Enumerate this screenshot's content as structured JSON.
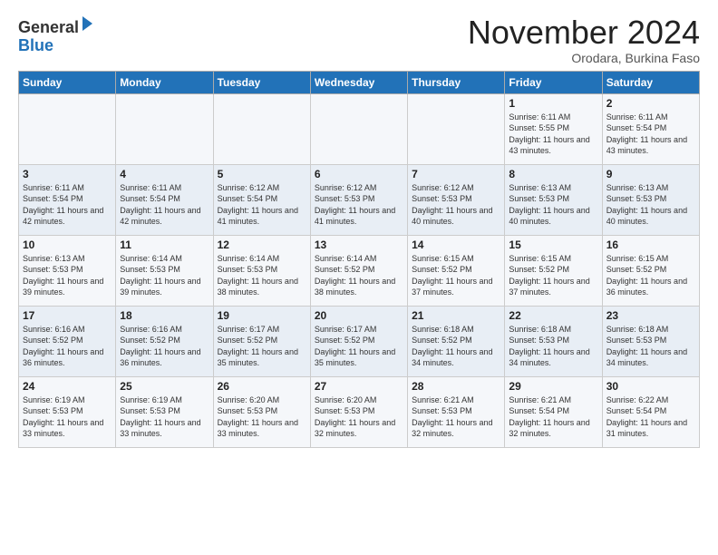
{
  "header": {
    "logo_general": "General",
    "logo_blue": "Blue",
    "month_title": "November 2024",
    "location": "Orodara, Burkina Faso"
  },
  "days_of_week": [
    "Sunday",
    "Monday",
    "Tuesday",
    "Wednesday",
    "Thursday",
    "Friday",
    "Saturday"
  ],
  "weeks": [
    [
      {
        "day": "",
        "info": ""
      },
      {
        "day": "",
        "info": ""
      },
      {
        "day": "",
        "info": ""
      },
      {
        "day": "",
        "info": ""
      },
      {
        "day": "",
        "info": ""
      },
      {
        "day": "1",
        "info": "Sunrise: 6:11 AM\nSunset: 5:55 PM\nDaylight: 11 hours\nand 43 minutes."
      },
      {
        "day": "2",
        "info": "Sunrise: 6:11 AM\nSunset: 5:54 PM\nDaylight: 11 hours\nand 43 minutes."
      }
    ],
    [
      {
        "day": "3",
        "info": "Sunrise: 6:11 AM\nSunset: 5:54 PM\nDaylight: 11 hours\nand 42 minutes."
      },
      {
        "day": "4",
        "info": "Sunrise: 6:11 AM\nSunset: 5:54 PM\nDaylight: 11 hours\nand 42 minutes."
      },
      {
        "day": "5",
        "info": "Sunrise: 6:12 AM\nSunset: 5:54 PM\nDaylight: 11 hours\nand 41 minutes."
      },
      {
        "day": "6",
        "info": "Sunrise: 6:12 AM\nSunset: 5:53 PM\nDaylight: 11 hours\nand 41 minutes."
      },
      {
        "day": "7",
        "info": "Sunrise: 6:12 AM\nSunset: 5:53 PM\nDaylight: 11 hours\nand 40 minutes."
      },
      {
        "day": "8",
        "info": "Sunrise: 6:13 AM\nSunset: 5:53 PM\nDaylight: 11 hours\nand 40 minutes."
      },
      {
        "day": "9",
        "info": "Sunrise: 6:13 AM\nSunset: 5:53 PM\nDaylight: 11 hours\nand 40 minutes."
      }
    ],
    [
      {
        "day": "10",
        "info": "Sunrise: 6:13 AM\nSunset: 5:53 PM\nDaylight: 11 hours\nand 39 minutes."
      },
      {
        "day": "11",
        "info": "Sunrise: 6:14 AM\nSunset: 5:53 PM\nDaylight: 11 hours\nand 39 minutes."
      },
      {
        "day": "12",
        "info": "Sunrise: 6:14 AM\nSunset: 5:53 PM\nDaylight: 11 hours\nand 38 minutes."
      },
      {
        "day": "13",
        "info": "Sunrise: 6:14 AM\nSunset: 5:52 PM\nDaylight: 11 hours\nand 38 minutes."
      },
      {
        "day": "14",
        "info": "Sunrise: 6:15 AM\nSunset: 5:52 PM\nDaylight: 11 hours\nand 37 minutes."
      },
      {
        "day": "15",
        "info": "Sunrise: 6:15 AM\nSunset: 5:52 PM\nDaylight: 11 hours\nand 37 minutes."
      },
      {
        "day": "16",
        "info": "Sunrise: 6:15 AM\nSunset: 5:52 PM\nDaylight: 11 hours\nand 36 minutes."
      }
    ],
    [
      {
        "day": "17",
        "info": "Sunrise: 6:16 AM\nSunset: 5:52 PM\nDaylight: 11 hours\nand 36 minutes."
      },
      {
        "day": "18",
        "info": "Sunrise: 6:16 AM\nSunset: 5:52 PM\nDaylight: 11 hours\nand 36 minutes."
      },
      {
        "day": "19",
        "info": "Sunrise: 6:17 AM\nSunset: 5:52 PM\nDaylight: 11 hours\nand 35 minutes."
      },
      {
        "day": "20",
        "info": "Sunrise: 6:17 AM\nSunset: 5:52 PM\nDaylight: 11 hours\nand 35 minutes."
      },
      {
        "day": "21",
        "info": "Sunrise: 6:18 AM\nSunset: 5:52 PM\nDaylight: 11 hours\nand 34 minutes."
      },
      {
        "day": "22",
        "info": "Sunrise: 6:18 AM\nSunset: 5:53 PM\nDaylight: 11 hours\nand 34 minutes."
      },
      {
        "day": "23",
        "info": "Sunrise: 6:18 AM\nSunset: 5:53 PM\nDaylight: 11 hours\nand 34 minutes."
      }
    ],
    [
      {
        "day": "24",
        "info": "Sunrise: 6:19 AM\nSunset: 5:53 PM\nDaylight: 11 hours\nand 33 minutes."
      },
      {
        "day": "25",
        "info": "Sunrise: 6:19 AM\nSunset: 5:53 PM\nDaylight: 11 hours\nand 33 minutes."
      },
      {
        "day": "26",
        "info": "Sunrise: 6:20 AM\nSunset: 5:53 PM\nDaylight: 11 hours\nand 33 minutes."
      },
      {
        "day": "27",
        "info": "Sunrise: 6:20 AM\nSunset: 5:53 PM\nDaylight: 11 hours\nand 32 minutes."
      },
      {
        "day": "28",
        "info": "Sunrise: 6:21 AM\nSunset: 5:53 PM\nDaylight: 11 hours\nand 32 minutes."
      },
      {
        "day": "29",
        "info": "Sunrise: 6:21 AM\nSunset: 5:54 PM\nDaylight: 11 hours\nand 32 minutes."
      },
      {
        "day": "30",
        "info": "Sunrise: 6:22 AM\nSunset: 5:54 PM\nDaylight: 11 hours\nand 31 minutes."
      }
    ]
  ]
}
